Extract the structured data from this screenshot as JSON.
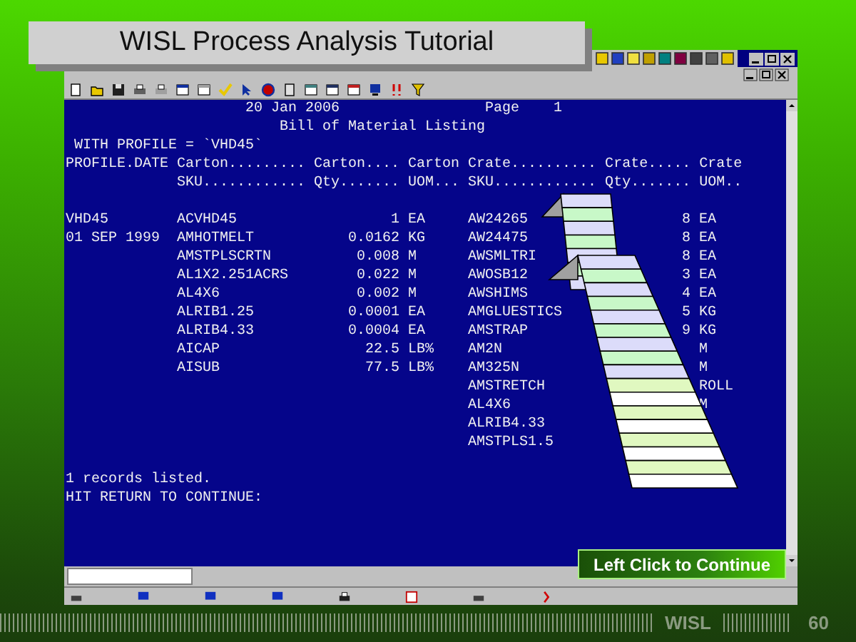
{
  "slide": {
    "title": "WISL Process Analysis Tutorial",
    "continue_button": "Left Click to Continue",
    "footer_label": "WISL",
    "page_number": "60"
  },
  "terminal": {
    "header_lines": [
      {
        "text": "                     20 Jan 2006                 Page    1"
      },
      {
        "text": "                         Bill of Material Listing"
      },
      {
        "text": " WITH PROFILE = `VHD45`"
      },
      {
        "text": "PROFILE.DATE Carton......... Carton.... Carton Crate.......... Crate..... Crate"
      },
      {
        "text": "             SKU............ Qty....... UOM... SKU............ Qty....... UOM.."
      }
    ],
    "rows": [
      {
        "profile": "VHD45",
        "carton_sku": "ACVHD45",
        "carton_qty": "1",
        "carton_uom": "EA",
        "crate_sku": "AW24265",
        "crate_qty": "8",
        "crate_uom": "EA"
      },
      {
        "profile": "01 SEP 1999",
        "carton_sku": "AMHOTMELT",
        "carton_qty": "0.0162",
        "carton_uom": "KG",
        "crate_sku": "AW24475",
        "crate_qty": "8",
        "crate_uom": "EA"
      },
      {
        "carton_sku": "AMSTPLSCRTN",
        "carton_qty": "0.008",
        "carton_uom": "M",
        "crate_sku": "AWSMLTRI",
        "crate_qty": "8",
        "crate_uom": "EA"
      },
      {
        "carton_sku": "AL1X2.251ACRS",
        "carton_qty": "0.022",
        "carton_uom": "M",
        "crate_sku": "AWOSB12",
        "crate_qty": "3",
        "crate_uom": "EA"
      },
      {
        "carton_sku": "AL4X6",
        "carton_qty": "0.002",
        "carton_uom": "M",
        "crate_sku": "AWSHIMS",
        "crate_qty": "4",
        "crate_uom": "EA"
      },
      {
        "carton_sku": "ALRIB1.25",
        "carton_qty": "0.0001",
        "carton_uom": "EA",
        "crate_sku": "AMGLUESTICS",
        "crate_qty": "5",
        "crate_uom": "KG"
      },
      {
        "carton_sku": "ALRIB4.33",
        "carton_qty": "0.0004",
        "carton_uom": "EA",
        "crate_sku": "AMSTRAP",
        "crate_qty": "9",
        "crate_uom": "KG"
      },
      {
        "carton_sku": "AICAP",
        "carton_qty": "22.5",
        "carton_uom": "LB%",
        "crate_sku": "AM2N",
        "crate_uom": "M"
      },
      {
        "carton_sku": "AISUB",
        "carton_qty": "77.5",
        "carton_uom": "LB%",
        "crate_sku": "AM325N",
        "crate_uom": "M"
      },
      {
        "crate_sku": "AMSTRETCH",
        "crate_uom": "ROLL"
      },
      {
        "crate_sku": "AL4X6",
        "crate_uom": "M"
      },
      {
        "crate_sku": "ALRIB4.33"
      },
      {
        "crate_sku": "AMSTPLS1.5"
      }
    ],
    "footer_lines": [
      {
        "text": "1 records listed."
      },
      {
        "text": "HIT RETURN TO CONTINUE:"
      }
    ]
  }
}
